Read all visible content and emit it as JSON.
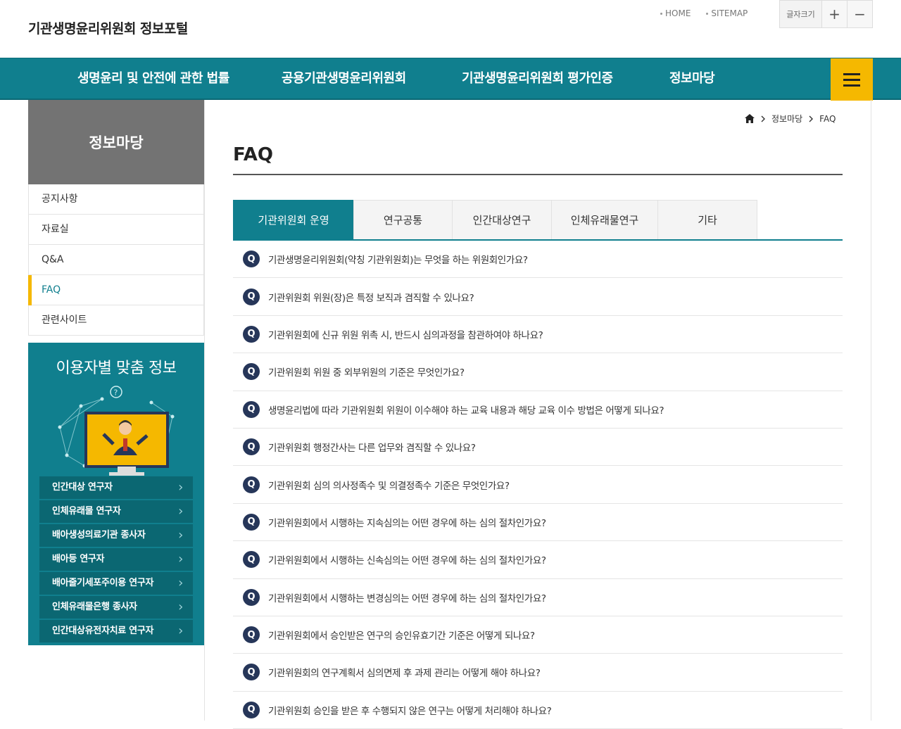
{
  "header": {
    "site_title": "기관생명윤리위원회 정보포털",
    "util_links": [
      "HOME",
      "SITEMAP"
    ],
    "font_size_label": "글자크기",
    "font_plus": "+",
    "font_minus": "−"
  },
  "gnb": {
    "items": [
      "생명윤리 및 안전에 관한 법률",
      "공용기관생명윤리위원회",
      "기관생명윤리위원회 평가인증",
      "정보마당"
    ]
  },
  "sidebar": {
    "title": "정보마당",
    "menu": [
      "공지사항",
      "자료실",
      "Q&A",
      "FAQ",
      "관련사이트"
    ],
    "active_index": 3,
    "user_box_title": "이용자별 맞춤 정보",
    "user_links": [
      "인간대상 연구자",
      "인체유래물 연구자",
      "배아생성의료기관 종사자",
      "배아등 연구자",
      "배아줄기세포주이용 연구자",
      "인체유래물은행 종사자",
      "인간대상유전자치료 연구자"
    ]
  },
  "breadcrumb": [
    "정보마당",
    "FAQ"
  ],
  "page_title": "FAQ",
  "tabs": [
    "기관위원회 운영",
    "연구공통",
    "인간대상연구",
    "인체유래물연구",
    "기타"
  ],
  "active_tab": 0,
  "faq": {
    "badge": "Q",
    "questions": [
      "기관생명윤리위원회(약칭 기관위원회)는 무엇을 하는 위원회인가요?",
      "기관위원회 위원(장)은 특정 보직과 겸직할 수 있나요?",
      "기관위원회에 신규 위원 위촉 시, 반드시 심의과정을 참관하여야 하나요?",
      "기관위원회 위원 중 외부위원의 기준은 무엇인가요?",
      "생명윤리법에 따라 기관위원회 위원이 이수해야 하는 교육 내용과 해당 교육 이수 방법은 어떻게 되나요?",
      "기관위원회 행정간사는 다른 업무와 겸직할 수 있나요?",
      "기관위원회 심의 의사정족수 및 의결정족수 기준은 무엇인가요?",
      "기관위원회에서 시행하는 지속심의는 어떤 경우에 하는 심의 절차인가요?",
      "기관위원회에서 시행하는 신속심의는 어떤 경우에 하는 심의 절차인가요?",
      "기관위원회에서 시행하는 변경심의는 어떤 경우에 하는 심의 절차인가요?",
      "기관위원회에서 승인받은 연구의 승인유효기간 기준은 어떻게 되나요?",
      "기관위원회의 연구계획서 심의면제 후 과제 관리는 어떻게 해야 하나요?",
      "기관위원회 승인을 받은 후 수행되지 않은 연구는 어떻게 처리해야 하나요?"
    ]
  },
  "colors": {
    "teal": "#107f8e",
    "yellow": "#f5b800",
    "navy": "#263659",
    "gray": "#737373"
  }
}
